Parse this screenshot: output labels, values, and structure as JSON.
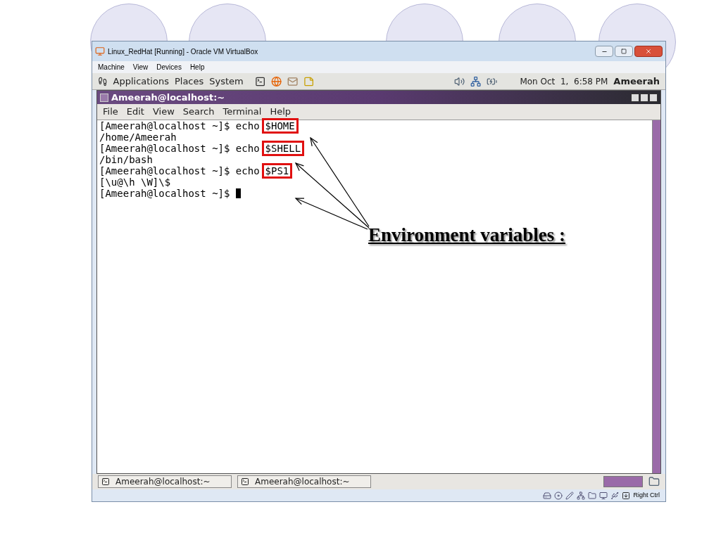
{
  "window": {
    "title": "Linux_RedHat [Running] - Oracle VM VirtualBox"
  },
  "menu": [
    "Machine",
    "View",
    "Devices",
    "Help"
  ],
  "guest_panel": {
    "menus": [
      "Applications",
      "Places",
      "System"
    ],
    "clock": "Mon Oct  1,  6:58 PM",
    "user": "Ameerah"
  },
  "terminal": {
    "title": "Ameerah@localhost:~",
    "menu": [
      "File",
      "Edit",
      "View",
      "Search",
      "Terminal",
      "Help"
    ],
    "lines": [
      {
        "kind": "command",
        "prompt": "[Ameerah@localhost ~]$ ",
        "command": "echo",
        "argument": "$HOME",
        "highlighted": true
      },
      {
        "kind": "output",
        "text": "/home/Ameerah"
      },
      {
        "kind": "command",
        "prompt": "[Ameerah@localhost ~]$ ",
        "command": "echo",
        "argument": "$SHELL",
        "highlighted": true
      },
      {
        "kind": "output",
        "text": "/bin/bash"
      },
      {
        "kind": "command",
        "prompt": "[Ameerah@localhost ~]$ ",
        "command": "echo",
        "argument": "$PS1",
        "highlighted": true
      },
      {
        "kind": "output",
        "text": "[\\u@\\h \\W]\\$"
      },
      {
        "kind": "prompt",
        "prompt": "[Ameerah@localhost ~]$ "
      }
    ]
  },
  "taskbar": [
    {
      "label": "Ameerah@localhost:~",
      "selected": false
    },
    {
      "label": "Ameerah@localhost:~",
      "selected": false
    }
  ],
  "status_bar": {
    "host_key": "Right Ctrl"
  },
  "annotation": "Environment variables :"
}
